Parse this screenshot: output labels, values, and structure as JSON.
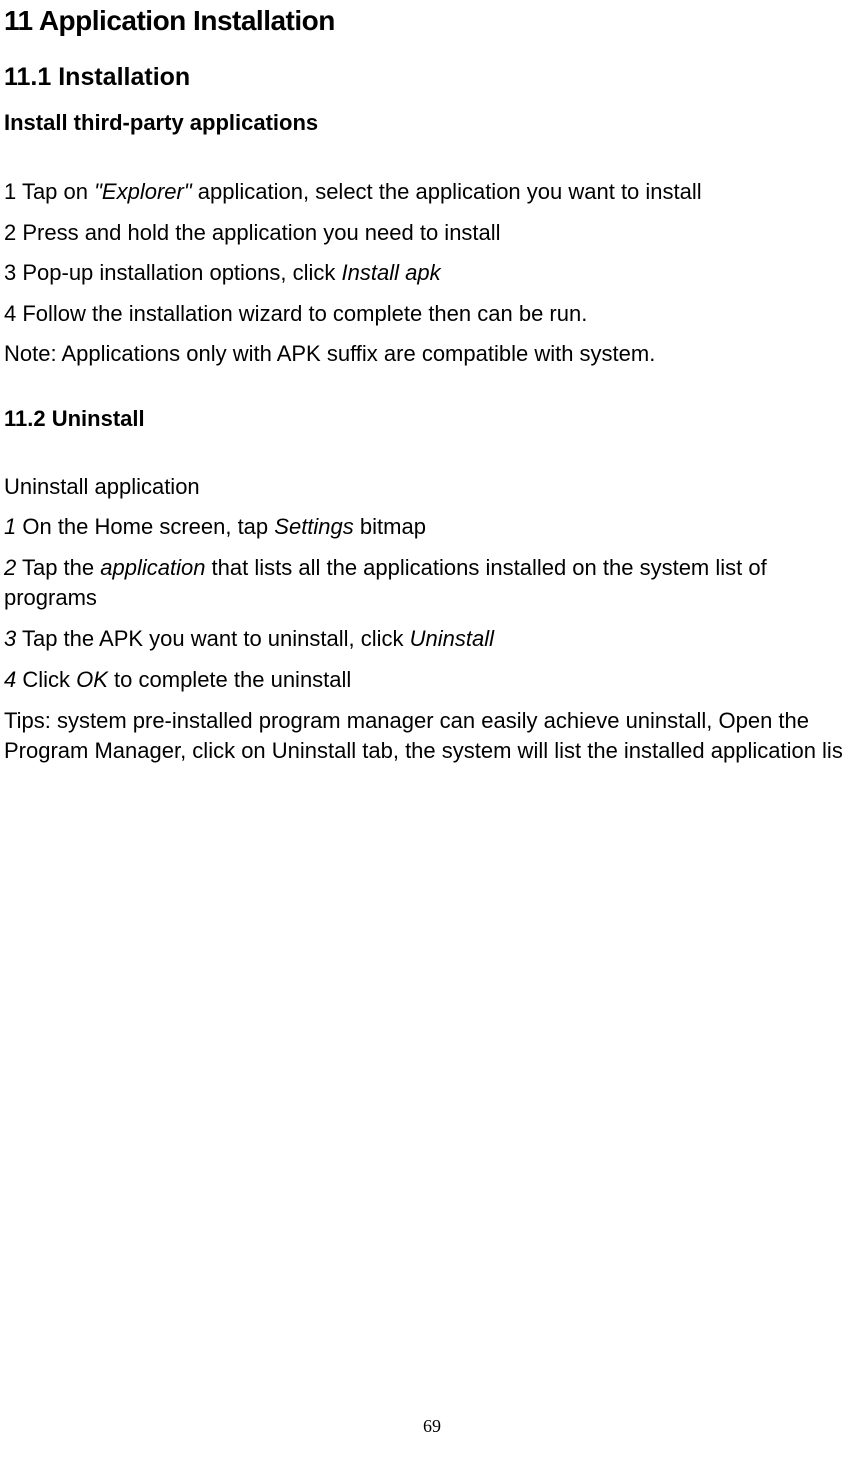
{
  "section": {
    "title": "11 Application Installation",
    "sub1": {
      "title": "11.1 Installation",
      "subtitle": "Install third-party applications",
      "step1_pre": "1 Tap on ",
      "step1_italic": "\"Explorer\"",
      "step1_post": " application, select the application you want to install",
      "step2": "2 Press and hold the application you need to install",
      "step3_pre": "3 Pop-up installation options, click ",
      "step3_italic": "Install apk",
      "step4": "4 Follow the installation wizard to complete then can be run.",
      "note": "Note: Applications only with APK suffix are compatible with system."
    },
    "sub2": {
      "title": "11.2 Uninstall",
      "subtitle": "Uninstall application",
      "step1_num": "1",
      "step1_pre": " On the Home screen, tap ",
      "step1_italic": "Settings",
      "step1_post": " bitmap",
      "step2_num": "2",
      "step2_pre": " Tap the ",
      "step2_italic": "application",
      "step2_post": " that lists all the applications installed on the system list of programs",
      "step3_num": "3",
      "step3_pre": " Tap the APK you want to uninstall, click ",
      "step3_italic": "Uninstall",
      "step4_num": "4",
      "step4_pre": " Click ",
      "step4_italic": "OK",
      "step4_post": " to complete the uninstall",
      "tips": "Tips: system pre-installed program manager can easily achieve uninstall, Open the Program Manager, click on Uninstall tab, the system will list the installed application lis"
    }
  },
  "page_number": "69"
}
